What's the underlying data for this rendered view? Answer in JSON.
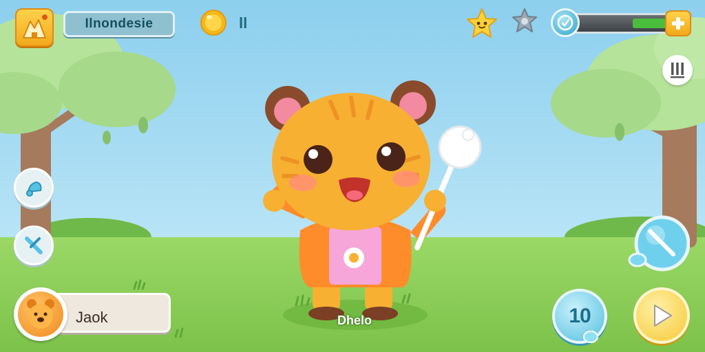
{
  "hud": {
    "player_tag": "Ilnondesie",
    "coin_count": "ll",
    "progress": {
      "fill_fraction": 0.36
    }
  },
  "player": {
    "name": "Jaok"
  },
  "character": {
    "label": "Dhelo"
  },
  "round": {
    "count": "10"
  },
  "colors": {
    "sky": "#a9dcf2",
    "grass": "#8fd158",
    "accent_yellow": "#f6c934",
    "accent_blue": "#54bfdf",
    "progress_green": "#4bbd3c"
  },
  "icons": {
    "home": "mountain-house-icon",
    "coin": "gold-coin-icon",
    "star": "star-face-icon",
    "badge": "gray-star-badge-icon",
    "gauge": "gauge-icon",
    "plus": "plus-icon",
    "pause": "pause-icon",
    "side_1": "bell-icon",
    "side_2": "tool-icon",
    "wand": "wand-icon",
    "play": "play-icon"
  }
}
